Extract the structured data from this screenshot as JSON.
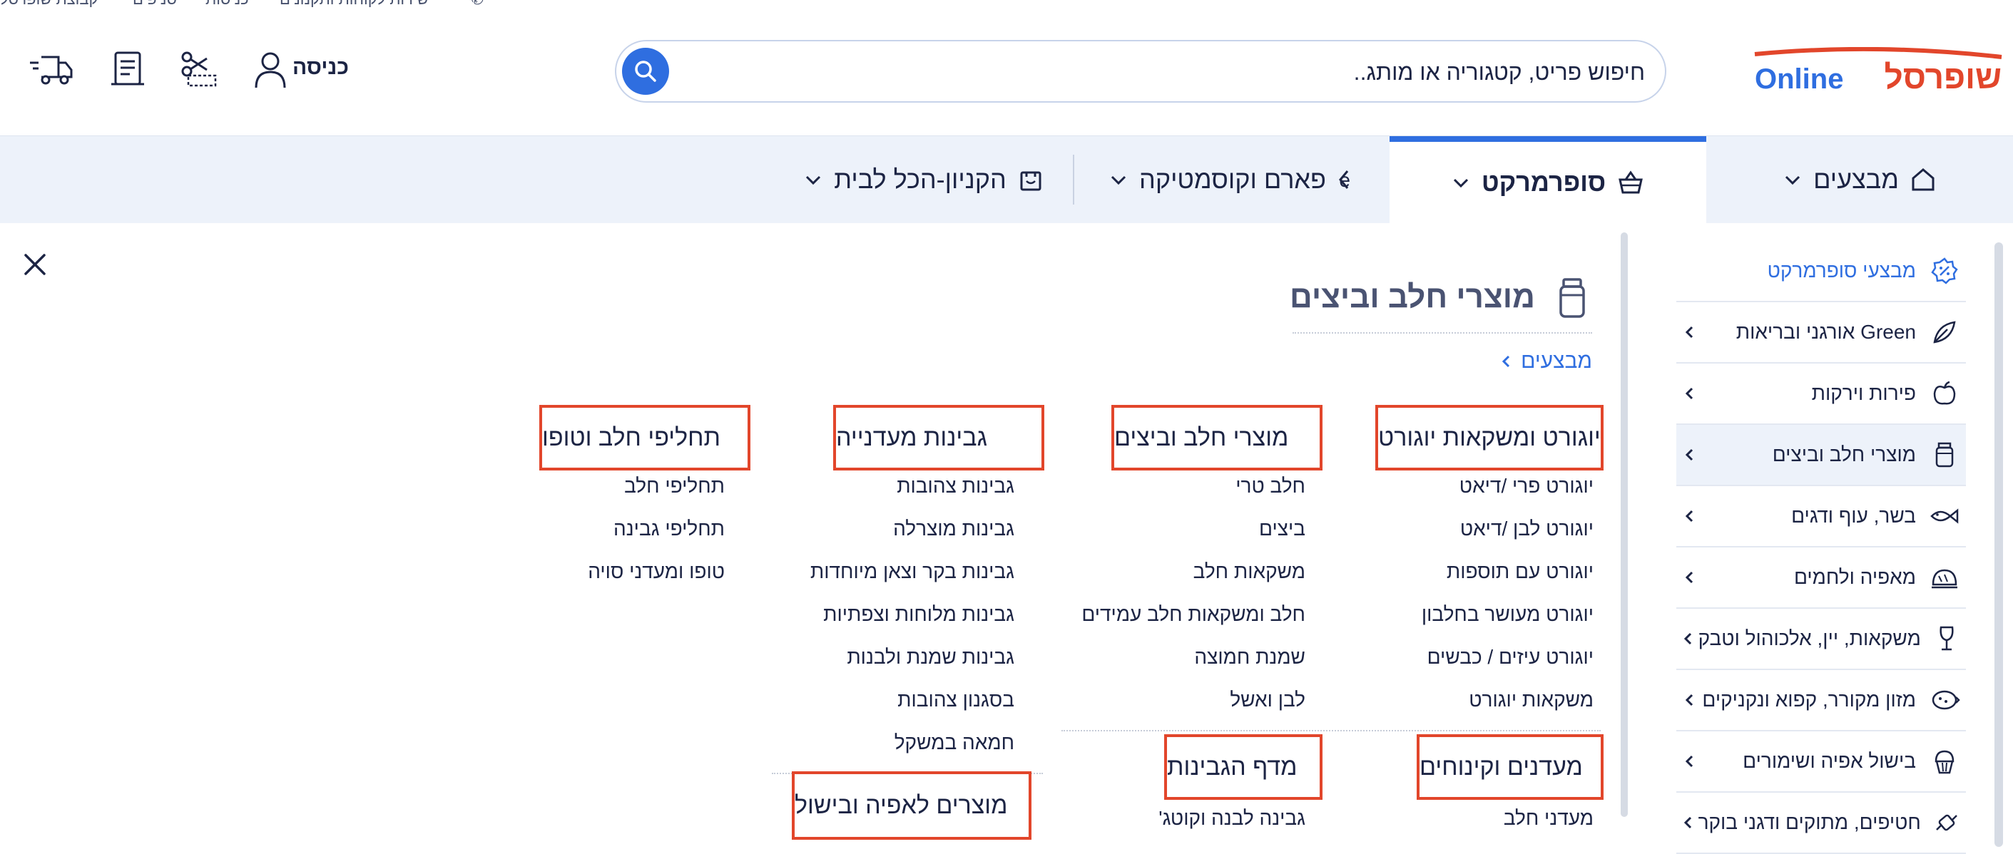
{
  "top_strip": {
    "items": [
      "קבוצת שופרסל",
      "סניפים",
      "כניסות",
      "שירות לקוחות ותקנונים"
    ]
  },
  "header": {
    "logo_text": "שופרסל Online",
    "search": {
      "placeholder": "חיפוש פריט, קטגוריה או מותג..",
      "value": ""
    },
    "login_label": "כניסה",
    "icons": [
      "user-icon",
      "coupon-scissors-icon",
      "receipt-icon",
      "delivery-truck-icon",
      "search-icon"
    ]
  },
  "nav": {
    "tabs": [
      {
        "label": "מבצעים",
        "icon": "home-icon",
        "active": false
      },
      {
        "label": "סופרמרקט",
        "icon": "basket-icon",
        "active": true
      },
      {
        "label": "פארם וקוסמטיקה",
        "icon": "be-pharm-icon",
        "active": false
      },
      {
        "label": "הקניון-הכל לבית",
        "icon": "bag-icon",
        "active": false
      }
    ]
  },
  "sidebar": {
    "items": [
      {
        "label": "מבצעי סופרמרקט",
        "icon": "sale-badge-icon",
        "promo": true,
        "chevron": false,
        "selected": false
      },
      {
        "label": "Green אורגני ובריאות",
        "icon": "leaf-icon",
        "promo": false,
        "chevron": true,
        "selected": false
      },
      {
        "label": "פירות וירקות",
        "icon": "apple-icon",
        "promo": false,
        "chevron": true,
        "selected": false
      },
      {
        "label": "מוצרי חלב וביצים",
        "icon": "milk-jar-icon",
        "promo": false,
        "chevron": true,
        "selected": true
      },
      {
        "label": "בשר, עוף ודגים",
        "icon": "fish-icon",
        "promo": false,
        "chevron": true,
        "selected": false
      },
      {
        "label": "מאפיה ולחמים",
        "icon": "bread-icon",
        "promo": false,
        "chevron": true,
        "selected": false
      },
      {
        "label": "משקאות, יין, אלכוהול וטבק",
        "icon": "wine-glass-icon",
        "promo": false,
        "chevron": true,
        "selected": false
      },
      {
        "label": "מזון מקורר, קפוא ונקניקים",
        "icon": "frozen-icon",
        "promo": false,
        "chevron": true,
        "selected": false
      },
      {
        "label": "בישול אפיה ושימורים",
        "icon": "cupcake-icon",
        "promo": false,
        "chevron": true,
        "selected": false
      },
      {
        "label": "חטיפים, מתוקים ודגני בוקר",
        "icon": "candy-icon",
        "promo": false,
        "chevron": true,
        "selected": false
      }
    ]
  },
  "main": {
    "title": "מוצרי חלב וביצים",
    "breadcrumb": "מבצעים",
    "categories": [
      {
        "title": "יוגורט ומשקאות יוגורט",
        "items": [
          "יוגורט פרי /דיאט",
          "יוגורט לבן /דיאט",
          "יוגורט עם תוספות",
          "יוגורט מעושר בחלבון",
          "יוגורט עיזים / כבשים",
          "משקאות יוגורט"
        ]
      },
      {
        "title": "מוצרי חלב וביצים",
        "items": [
          "חלב טרי",
          "ביצים",
          "משקאות חלב",
          "חלב ומשקאות חלב עמידים",
          "שמנת חמוצה",
          "לבן ואשל"
        ]
      },
      {
        "title": "גבינות מעדנייה",
        "items": [
          "גבינות צהובות",
          "גבינות מוצרלה",
          "גבינות בקר וצאן מיוחדות",
          "גבינות מלוחות וצפתיות",
          "גבינות שמנת ולבנות",
          "בסגנון צהובות",
          "חמאה במשקל"
        ]
      },
      {
        "title": "תחליפי חלב וטופו",
        "items": [
          "תחליפי חלב",
          "תחליפי גבינה",
          "טופו ומעדני סויה"
        ]
      },
      {
        "title": "מעדנים וקינוחים",
        "items": [
          "מעדני חלב"
        ]
      },
      {
        "title": "מדף הגבינות",
        "items": [
          "גבינה לבנה וקוטג'"
        ]
      },
      {
        "title": "מוצרים לאפיה ובישול",
        "items": []
      }
    ]
  },
  "colors": {
    "accent": "#2f6ee0",
    "brand_red": "#e2462b",
    "text": "#1c2444",
    "nav_bg": "#edf2fa"
  }
}
